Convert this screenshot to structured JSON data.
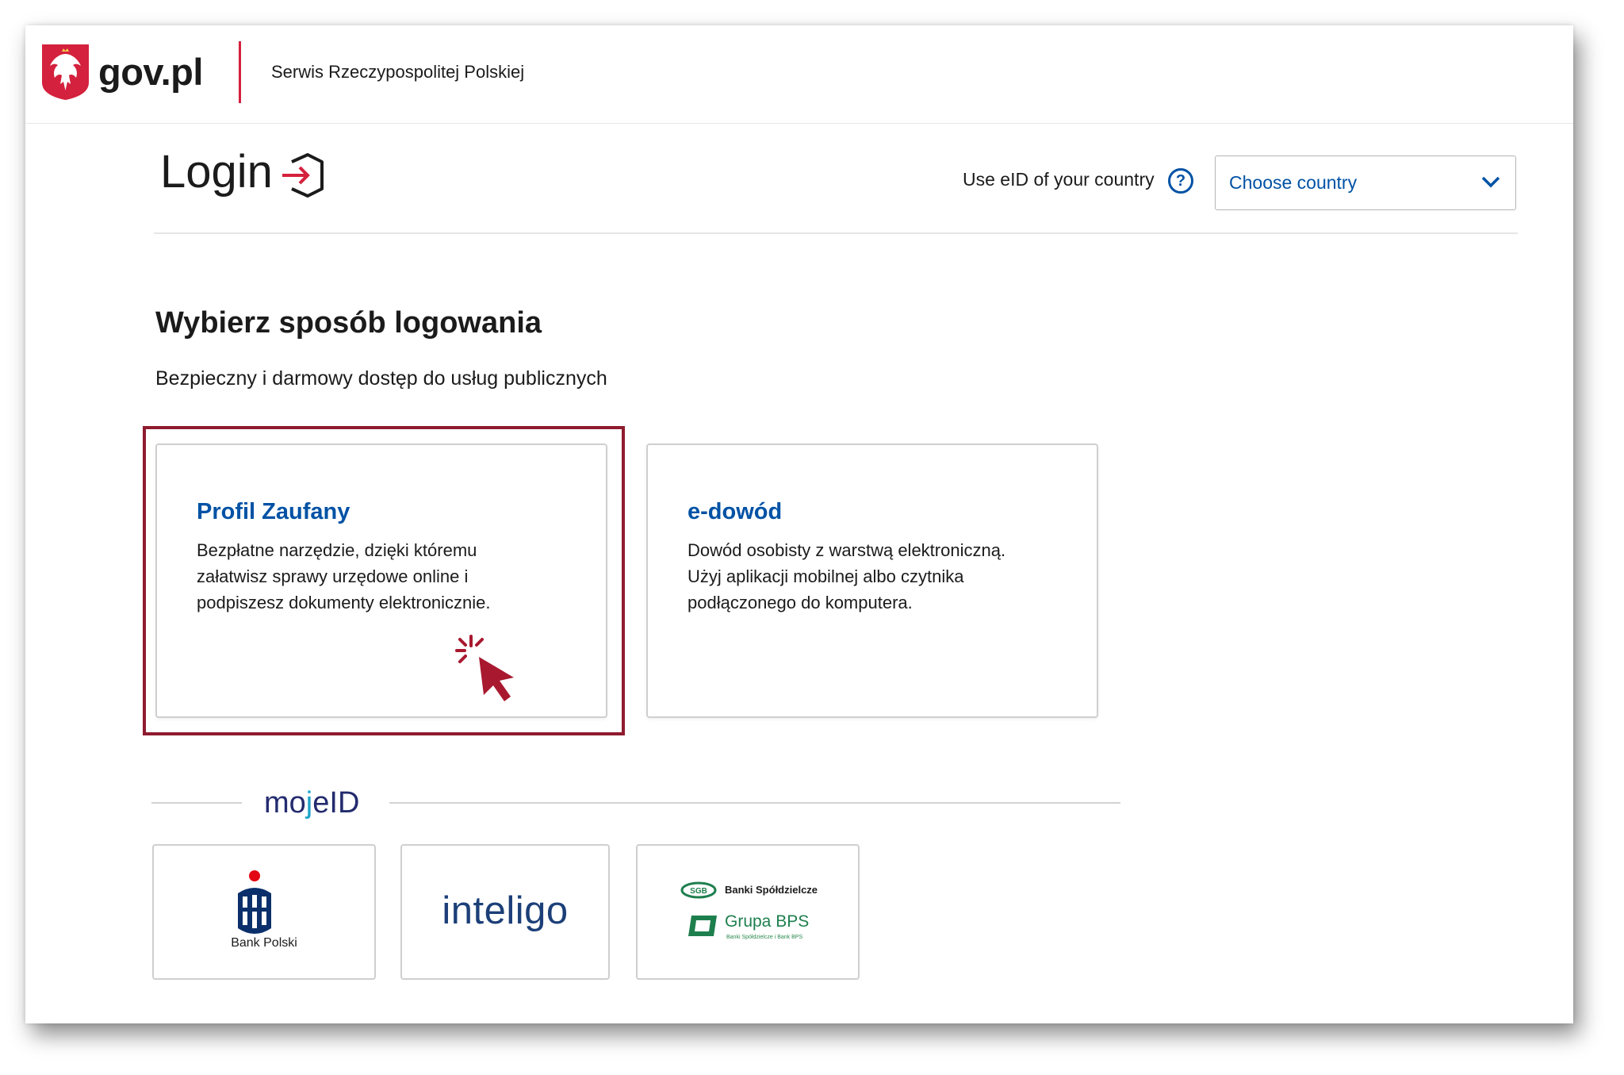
{
  "header": {
    "brand": "gov.pl",
    "service": "Serwis Rzeczypospolitej Polskiej",
    "emblem_icon": "polish-eagle-emblem"
  },
  "login": {
    "title": "Login",
    "icon": "login-arrow-icon",
    "eid_label": "Use eID of your country",
    "help_icon": "question-icon",
    "help_symbol": "?",
    "country_select": {
      "value": "Choose country",
      "icon": "chevron-down-icon"
    }
  },
  "section": {
    "title": "Wybierz sposób logowania",
    "subtitle": "Bezpieczny i darmowy dostęp do usług publicznych"
  },
  "methods": [
    {
      "title": "Profil Zaufany",
      "description": "Bezpłatne narzędzie, dzięki któremu załatwisz sprawy urzędowe online i podpiszesz dokumenty elektronicznie.",
      "highlighted": true
    },
    {
      "title": "e-dowód",
      "description": "Dowód osobisty z warstwą elektroniczną. Użyj aplikacji mobilnej albo czytnika podłączonego do komputera."
    }
  ],
  "mojeid": {
    "logo_pre": "m",
    "logo_o": "o",
    "logo_j": "j",
    "logo_post": "eID",
    "banks": [
      {
        "name": "Bank Polski",
        "logo": "pko-bank-polski-logo"
      },
      {
        "name": "inteligo",
        "logo": "inteligo-logo"
      },
      {
        "name": "Banki Spółdzielcze",
        "subname": "Grupa BPS",
        "small": "Banki Spółdzielcze i Bank BPS",
        "short": "SGB",
        "logo": "sgb-grupa-bps-logo"
      }
    ]
  },
  "colors": {
    "accent": "#0052a5",
    "highlight": "#8f1b2f",
    "gov_red": "#d4213d"
  }
}
